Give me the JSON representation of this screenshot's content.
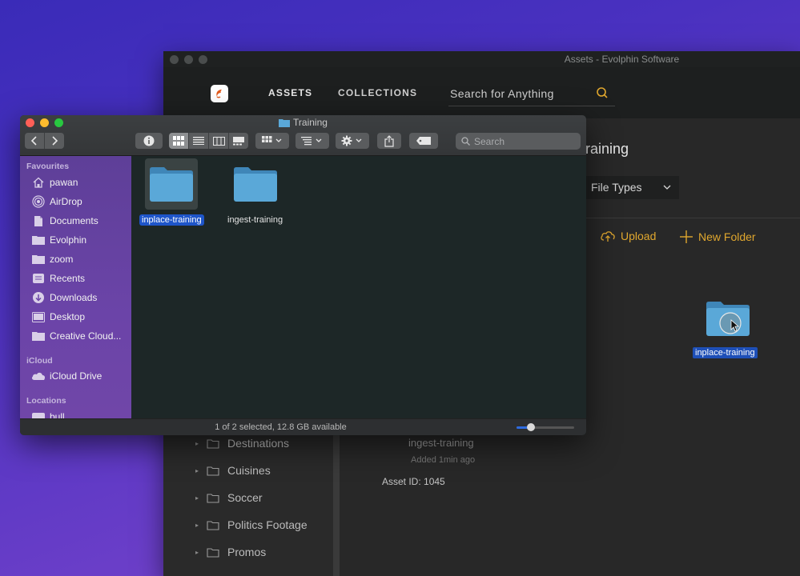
{
  "evolphin": {
    "window_title": "Assets - Evolphin Software",
    "nav": {
      "assets": "ASSETS",
      "collections": "COLLECTIONS"
    },
    "search_placeholder": "Search for Anything",
    "heading": "raining",
    "file_types": "File Types",
    "actions": {
      "upload": "Upload",
      "new_folder": "New Folder"
    },
    "tree": [
      "Destinations",
      "Cuisines",
      "Soccer",
      "Politics Footage",
      "Promos"
    ],
    "asset": {
      "name": "ingest-training",
      "added": "Added 1min ago",
      "id": "Asset ID: 1045"
    },
    "dragged_item": "inplace-training",
    "accent": "#e0a72e"
  },
  "finder": {
    "title": "Training",
    "search_placeholder": "Search",
    "sidebar": {
      "favourites_label": "Favourites",
      "favourites": [
        {
          "label": "pawan",
          "icon": "home-icon"
        },
        {
          "label": "AirDrop",
          "icon": "airdrop-icon"
        },
        {
          "label": "Documents",
          "icon": "document-icon"
        },
        {
          "label": "Evolphin",
          "icon": "folder-icon"
        },
        {
          "label": "zoom",
          "icon": "folder-icon"
        },
        {
          "label": "Recents",
          "icon": "recents-icon"
        },
        {
          "label": "Downloads",
          "icon": "download-icon"
        },
        {
          "label": "Desktop",
          "icon": "desktop-icon"
        },
        {
          "label": "Creative Cloud...",
          "icon": "folder-icon"
        }
      ],
      "icloud_label": "iCloud",
      "icloud": [
        {
          "label": "iCloud Drive",
          "icon": "cloud-icon"
        }
      ],
      "locations_label": "Locations",
      "locations": [
        {
          "label": "bull",
          "icon": "drive-icon"
        }
      ]
    },
    "files": [
      {
        "name": "inplace-training",
        "selected": true
      },
      {
        "name": "ingest-training",
        "selected": false
      }
    ],
    "status": "1 of 2 selected, 12.8 GB available",
    "icon_size_fraction": 0.25,
    "selection_color": "#1e55c9"
  }
}
